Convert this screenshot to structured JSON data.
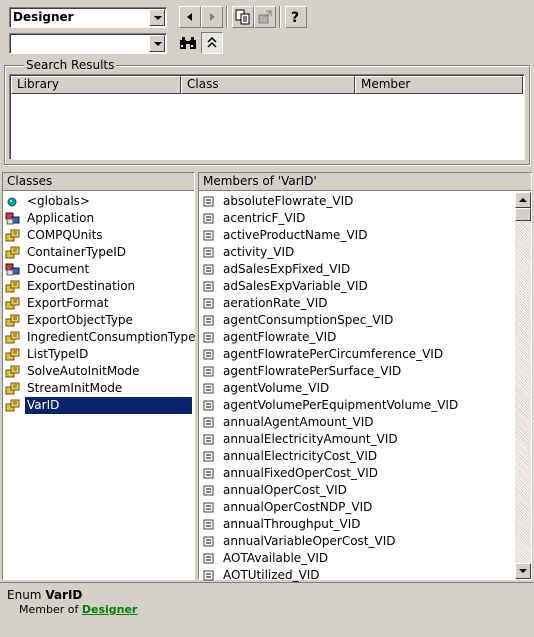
{
  "toolbar": {
    "library_value": "Designer",
    "search_value": "",
    "buttons": {
      "back": "back-arrow-icon",
      "forward": "forward-arrow-icon",
      "copy": "copy-icon",
      "view_definition": "view-definition-icon",
      "help": "help-icon",
      "search": "binoculars-icon",
      "toggle_results": "collapse-chevron-icon"
    }
  },
  "search_results": {
    "title": "Search Results",
    "columns": [
      "Library",
      "Class",
      "Member"
    ]
  },
  "classes": {
    "header": "Classes",
    "items": [
      {
        "label": "<globals>",
        "icon": "globals-icon"
      },
      {
        "label": "Application",
        "icon": "class-icon"
      },
      {
        "label": "COMPQUnits",
        "icon": "enum-icon"
      },
      {
        "label": "ContainerTypeID",
        "icon": "enum-icon"
      },
      {
        "label": "Document",
        "icon": "class-icon"
      },
      {
        "label": "ExportDestination",
        "icon": "enum-icon"
      },
      {
        "label": "ExportFormat",
        "icon": "enum-icon"
      },
      {
        "label": "ExportObjectType",
        "icon": "enum-icon"
      },
      {
        "label": "IngredientConsumptionType",
        "icon": "enum-icon"
      },
      {
        "label": "ListTypeID",
        "icon": "enum-icon"
      },
      {
        "label": "SolveAutoInitMode",
        "icon": "enum-icon"
      },
      {
        "label": "StreamInitMode",
        "icon": "enum-icon"
      },
      {
        "label": "VarID",
        "icon": "enum-icon",
        "selected": true
      }
    ]
  },
  "members": {
    "header": "Members of 'VarID'",
    "items": [
      "absoluteFlowrate_VID",
      "acentricF_VID",
      "activeProductName_VID",
      "activity_VID",
      "adSalesExpFixed_VID",
      "adSalesExpVariable_VID",
      "aerationRate_VID",
      "agentConsumptionSpec_VID",
      "agentFlowrate_VID",
      "agentFlowratePerCircumference_VID",
      "agentFlowratePerSurface_VID",
      "agentVolume_VID",
      "agentVolumePerEquipmentVolume_VID",
      "annualAgentAmount_VID",
      "annualElectricityAmount_VID",
      "annualElectricityCost_VID",
      "annualFixedOperCost_VID",
      "annualOperCost_VID",
      "annualOperCostNDP_VID",
      "annualThroughput_VID",
      "annualVariableOperCost_VID",
      "AOTAvailable_VID",
      "AOTUtilized_VID"
    ]
  },
  "details": {
    "kind": "Enum",
    "name": "VarID",
    "member_of_label": "Member of",
    "member_of_link": "Designer",
    "link_color": "#008000"
  },
  "colors": {
    "selection": "#0a246a",
    "face": "#d4d0c8"
  }
}
